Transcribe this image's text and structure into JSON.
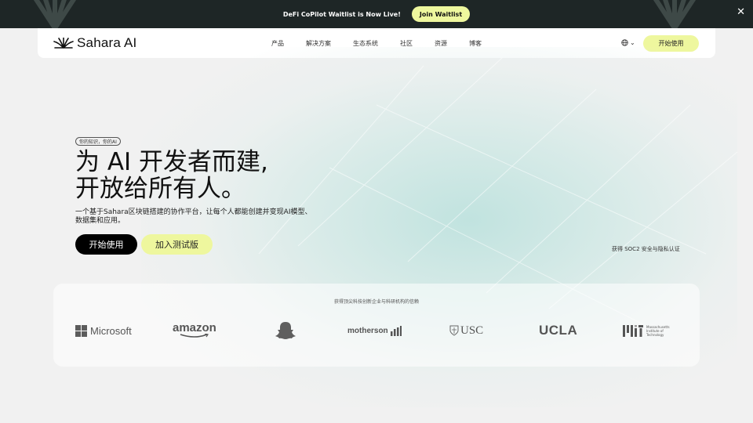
{
  "announcement": {
    "text": "DeFi CoPilot Waitlist is Now Live!",
    "button_label": "Join Waitlist",
    "close_glyph": "✕"
  },
  "navbar": {
    "logo_text": "Sahara AI",
    "links": [
      "产品",
      "解决方案",
      "生态系统",
      "社区",
      "资源",
      "博客"
    ],
    "language_icon": "globe-icon",
    "language_chevron": "⌄",
    "cta_label": "开始使用"
  },
  "hero": {
    "tag": "你的知识，你的AI",
    "headline_line1": "为 AI 开发者而建,",
    "headline_line2": "开放给所有人。",
    "subtext_line1": "一个基于Sahara区块链搭建的协作平台，让每个人都能创建并变现AI模型、",
    "subtext_line2": "数据集和应用。",
    "primary_button": "开始使用",
    "secondary_button": "加入测试版",
    "certification": "获得 SOC2 安全与隐私认证"
  },
  "partners": {
    "caption": "获得顶尖科技创新企业与科研机构的信赖",
    "logos": {
      "microsoft": "Microsoft",
      "amazon": "amazon",
      "snapchat": "snapchat-ghost-icon",
      "motherson": "motherson",
      "usc": "USC",
      "ucla": "UCLA",
      "mit_line1": "Massachusetts",
      "mit_line2": "Institute of",
      "mit_line3": "Technology"
    }
  },
  "colors": {
    "announcement_bg": "#1e2626",
    "accent_yellow": "#eef79e",
    "primary_button": "#000000",
    "glow_teal": "#bee2de",
    "page_bg": "#f1f1f1"
  }
}
